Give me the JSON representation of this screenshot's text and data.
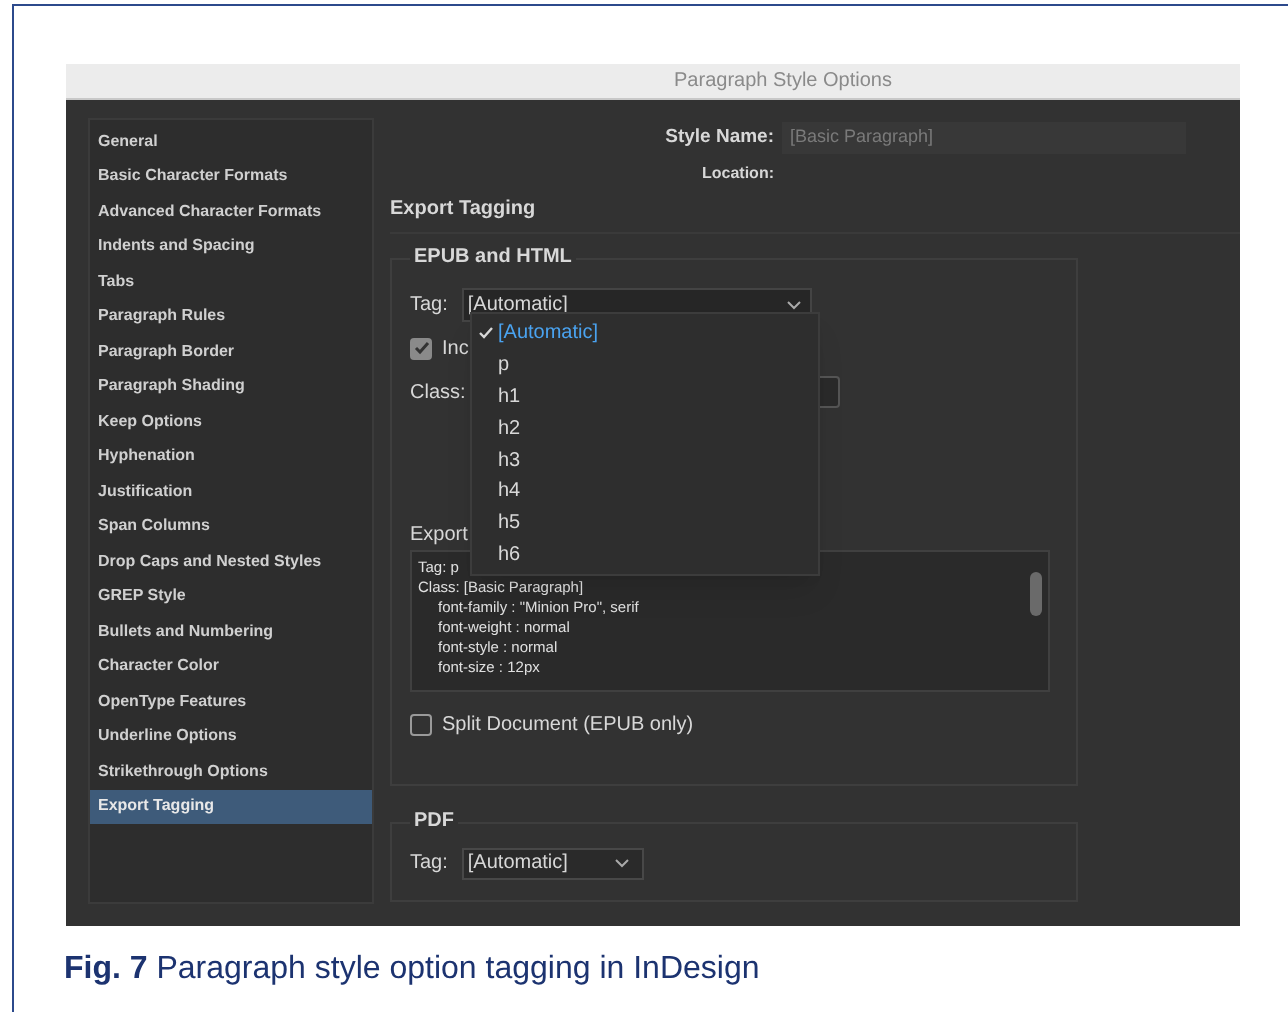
{
  "window": {
    "title": "Paragraph Style Options"
  },
  "sidebar": {
    "items": [
      {
        "label": "General",
        "selected": false
      },
      {
        "label": "Basic Character Formats",
        "selected": false
      },
      {
        "label": "Advanced Character Formats",
        "selected": false
      },
      {
        "label": "Indents and Spacing",
        "selected": false
      },
      {
        "label": "Tabs",
        "selected": false
      },
      {
        "label": "Paragraph Rules",
        "selected": false
      },
      {
        "label": "Paragraph Border",
        "selected": false
      },
      {
        "label": "Paragraph Shading",
        "selected": false
      },
      {
        "label": "Keep Options",
        "selected": false
      },
      {
        "label": "Hyphenation",
        "selected": false
      },
      {
        "label": "Justification",
        "selected": false
      },
      {
        "label": "Span Columns",
        "selected": false
      },
      {
        "label": "Drop Caps and Nested Styles",
        "selected": false
      },
      {
        "label": "GREP Style",
        "selected": false
      },
      {
        "label": "Bullets and Numbering",
        "selected": false
      },
      {
        "label": "Character Color",
        "selected": false
      },
      {
        "label": "OpenType Features",
        "selected": false
      },
      {
        "label": "Underline Options",
        "selected": false
      },
      {
        "label": "Strikethrough Options",
        "selected": false
      },
      {
        "label": "Export Tagging",
        "selected": true
      }
    ]
  },
  "style_name": {
    "label": "Style Name:",
    "value": "[Basic Paragraph]"
  },
  "location": {
    "label": "Location:"
  },
  "section_title": "Export Tagging",
  "epub_html": {
    "title": "EPUB and HTML",
    "tag": {
      "label": "Tag:",
      "value": "[Automatic]"
    },
    "tag_menu": {
      "items": [
        {
          "label": "[Automatic]",
          "selected": true
        },
        {
          "label": "p",
          "selected": false
        },
        {
          "label": "h1",
          "selected": false
        },
        {
          "label": "h2",
          "selected": false
        },
        {
          "label": "h3",
          "selected": false
        },
        {
          "label": "h4",
          "selected": false
        },
        {
          "label": "h5",
          "selected": false
        },
        {
          "label": "h6",
          "selected": false
        }
      ]
    },
    "include_checkbox": {
      "label": "Inc",
      "checked": true
    },
    "class": {
      "label": "Class:"
    },
    "export_details": {
      "label": "Export",
      "lines": [
        {
          "text": "Tag: p"
        },
        {
          "text": "Class: [Basic Paragraph]",
          "children": [
            {
              "text": "font-family : \"Minion Pro\", serif"
            },
            {
              "text": "font-weight : normal"
            },
            {
              "text": "font-style : normal"
            },
            {
              "text": "font-size : 12px"
            }
          ]
        }
      ]
    },
    "split_document": {
      "label": "Split Document (EPUB only)",
      "checked": false
    }
  },
  "pdf": {
    "title": "PDF",
    "tag": {
      "label": "Tag:",
      "value": "[Automatic]"
    }
  },
  "caption": "**Fig. 7** Paragraph style option tagging in InDesign"
}
